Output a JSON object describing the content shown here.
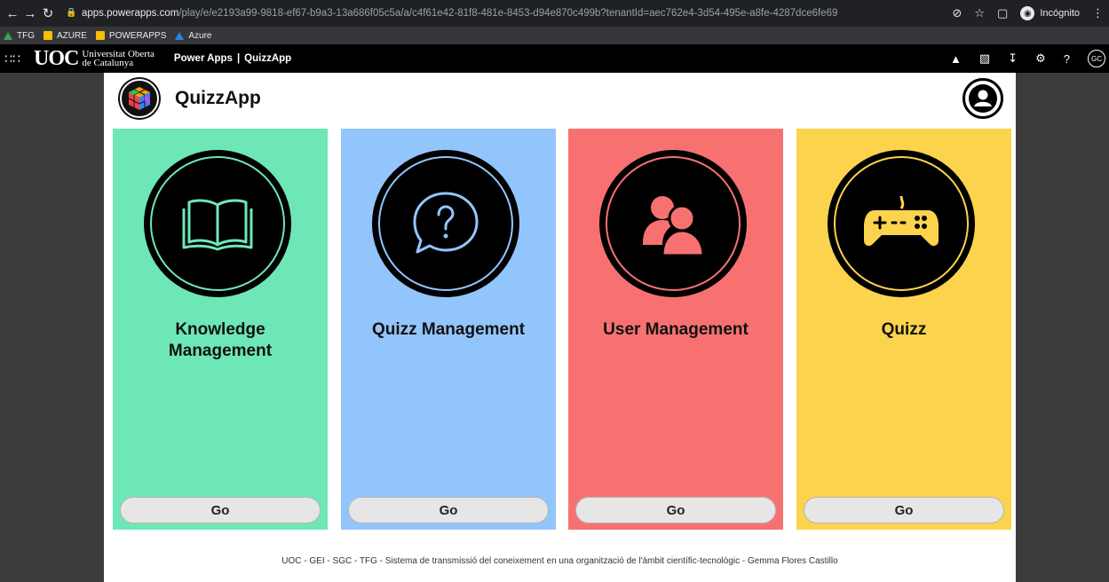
{
  "browser": {
    "url_host": "apps.powerapps.com",
    "url_path": "/play/e/e2193a99-9818-ef67-b9a3-13a686f05c5a/a/c4f61e42-81f8-481e-8453-d94e870c499b?tenantId=aec762e4-3d54-495e-a8fe-4287dce6fe69",
    "incognito_label": "Incógnito",
    "bookmarks": [
      {
        "label": "TFG",
        "icon": "drive-icon"
      },
      {
        "label": "AZURE",
        "icon": "folder-icon"
      },
      {
        "label": "POWERAPPS",
        "icon": "folder-icon"
      },
      {
        "label": "Azure",
        "icon": "azure-icon"
      }
    ]
  },
  "powerapps_header": {
    "org_line1": "Universitat Oberta",
    "org_line2": "de Catalunya",
    "org_mark": "UOC",
    "product": "Power Apps",
    "separator": "|",
    "app_name": "QuizzApp",
    "avatar_initials": "GC"
  },
  "app": {
    "title": "QuizzApp",
    "tiles": [
      {
        "label": "Knowledge Management",
        "button": "Go",
        "color": "#6ee7b7",
        "ring": "#6ee7b7",
        "icon": "book-icon"
      },
      {
        "label": "Quizz Management",
        "button": "Go",
        "color": "#93c5fd",
        "ring": "#93c5fd",
        "icon": "question-bubble-icon"
      },
      {
        "label": "User Management",
        "button": "Go",
        "color": "#f87171",
        "ring": "#f87171",
        "icon": "users-icon"
      },
      {
        "label": "Quizz",
        "button": "Go",
        "color": "#fcd34d",
        "ring": "#fcd34d",
        "icon": "gamepad-icon"
      }
    ],
    "footer": "UOC - GEI - SGC - TFG - Sistema de transmissió del coneixement en una organització de l'àmbit científic-tecnològic - Gemma Flores Castillo"
  }
}
